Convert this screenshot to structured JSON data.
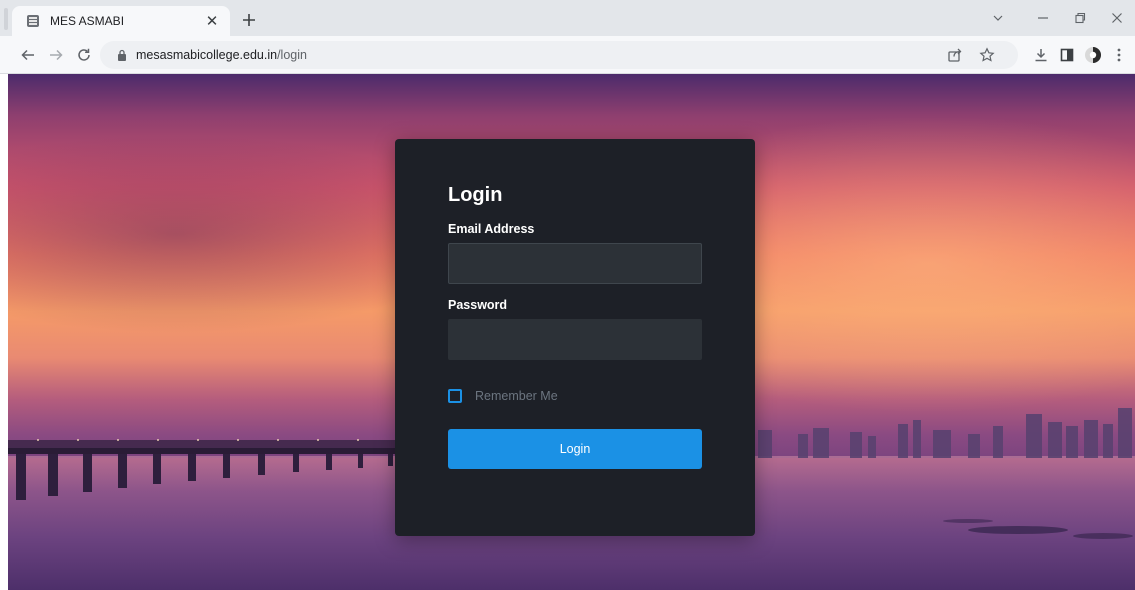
{
  "browser": {
    "tab": {
      "title": "MES ASMABI",
      "favicon": "college-crest-icon"
    },
    "url": {
      "domain": "mesasmabicollege.edu.in",
      "path": "/login"
    }
  },
  "login": {
    "title": "Login",
    "email_label": "Email Address",
    "email_value": "",
    "password_label": "Password",
    "password_value": "",
    "remember_label": "Remember Me",
    "remember_checked": false,
    "submit_label": "Login"
  },
  "colors": {
    "card_bg": "#1d2027",
    "input_bg": "#2c3137",
    "accent": "#1b91e5"
  }
}
